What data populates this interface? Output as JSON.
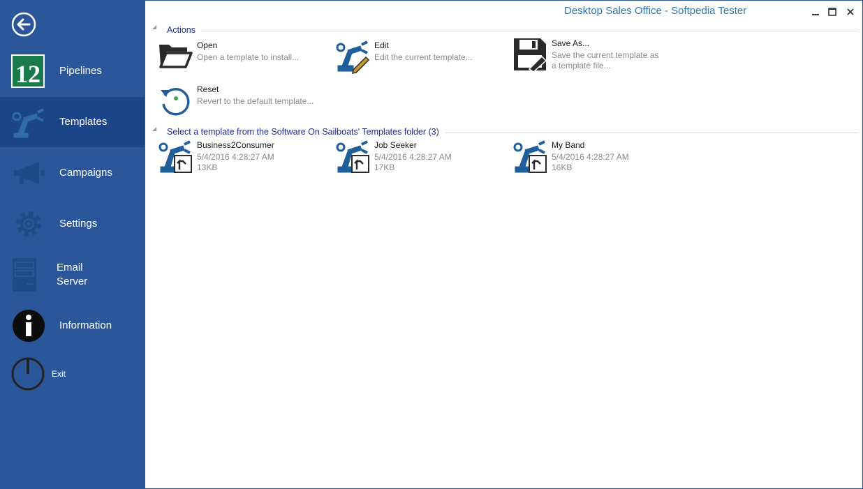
{
  "app": {
    "title": "Desktop Sales Office - Softpedia Tester"
  },
  "sidebar": {
    "items": [
      {
        "label": "Pipelines",
        "icon": "calendar-12-icon"
      },
      {
        "label": "Templates",
        "icon": "robot-arm-icon",
        "selected": true
      },
      {
        "label": "Campaigns",
        "icon": "megaphone-icon"
      },
      {
        "label": "Settings",
        "icon": "gear-icon"
      },
      {
        "label_line1": "Email",
        "label_line2": "Server",
        "icon": "server-icon"
      },
      {
        "label": "Information",
        "icon": "info-icon"
      },
      {
        "label": "Exit",
        "icon": "power-icon"
      }
    ]
  },
  "actions": {
    "header": "Actions",
    "open": {
      "name": "Open",
      "desc": "Open a template to install..."
    },
    "edit": {
      "name": "Edit",
      "desc": "Edit the current template..."
    },
    "save_as": {
      "name": "Save As...",
      "desc_line1": "Save the current template as",
      "desc_line2": "a template file..."
    },
    "reset": {
      "name": "Reset",
      "desc": "Revert to the default template..."
    }
  },
  "templates": {
    "header": "Select a template from the Software On Sailboats' Templates folder (3)",
    "items": [
      {
        "name": "Business2Consumer",
        "date": "5/4/2016 4:28:27 AM",
        "size": "13KB"
      },
      {
        "name": "Job Seeker",
        "date": "5/4/2016 4:28:27 AM",
        "size": "17KB"
      },
      {
        "name": "My Band",
        "date": "5/4/2016 4:28:27 AM",
        "size": "16KB"
      }
    ]
  },
  "colors": {
    "sidebar": "#2b579a",
    "selected": "#1d4688",
    "accent": "#2e75b6",
    "group_header": "#1f2f8f"
  }
}
